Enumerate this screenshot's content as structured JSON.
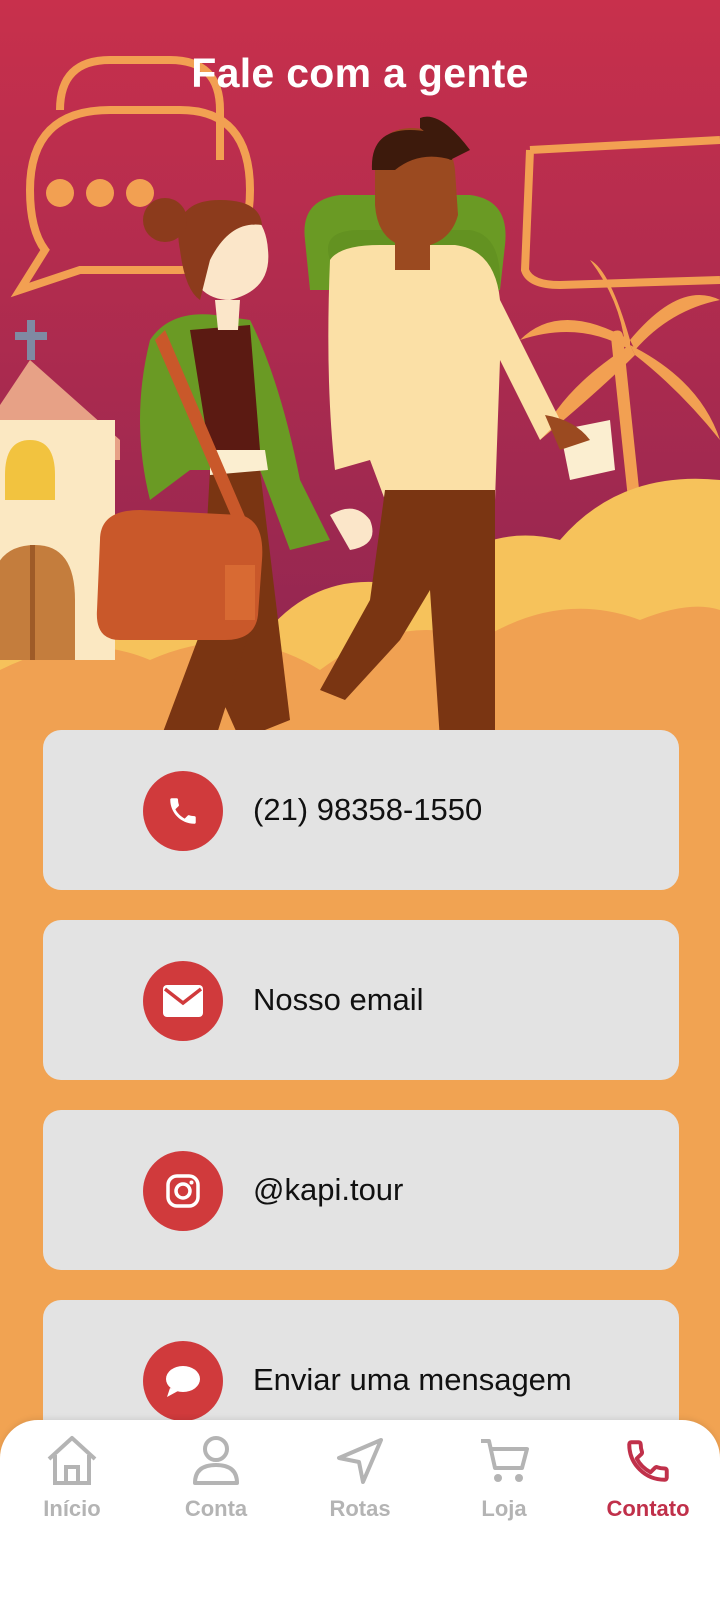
{
  "header": {
    "title": "Fale com a gente"
  },
  "contacts": [
    {
      "label": "(21) 98358-1550",
      "icon": "phone-icon"
    },
    {
      "label": "Nosso email",
      "icon": "envelope-icon"
    },
    {
      "label": "@kapi.tour",
      "icon": "instagram-icon"
    },
    {
      "label": "Enviar uma mensagem",
      "icon": "chat-bubble-icon"
    }
  ],
  "nav": {
    "items": [
      {
        "label": "Início",
        "icon": "home-icon",
        "active": false
      },
      {
        "label": "Conta",
        "icon": "user-icon",
        "active": false
      },
      {
        "label": "Rotas",
        "icon": "navigation-arrow-icon",
        "active": false
      },
      {
        "label": "Loja",
        "icon": "cart-icon",
        "active": false
      },
      {
        "label": "Contato",
        "icon": "phone-icon",
        "active": true
      }
    ]
  },
  "colors": {
    "header_bg_top": "#c8304c",
    "header_bg_bottom": "#8a2450",
    "body_bg": "#f1a352",
    "card_bg": "#e3e3e3",
    "icon_circle": "#d03a3c",
    "nav_active": "#c0304a",
    "nav_inactive": "#b4b4b4"
  }
}
